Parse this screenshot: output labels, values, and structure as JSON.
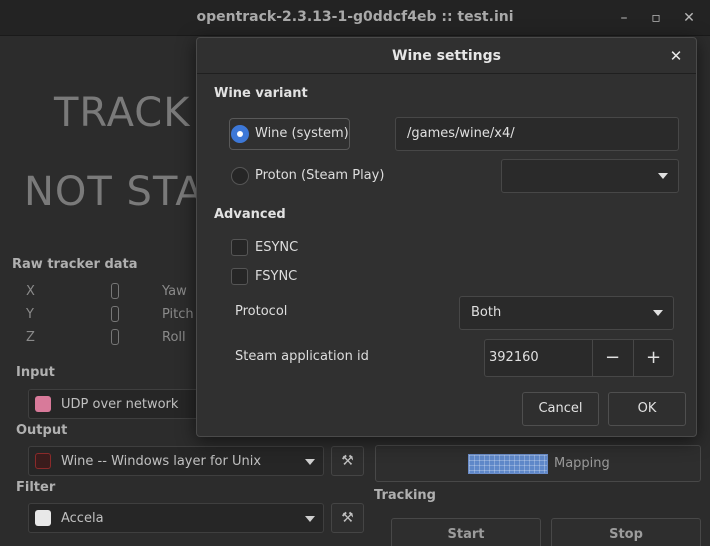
{
  "window": {
    "title": "opentrack-2.3.13-1-g0ddcf4eb :: test.ini",
    "minimize_glyph": "–",
    "maximize_glyph": "▫",
    "close_glyph": "✕"
  },
  "main": {
    "status_line1": "TRACK",
    "status_line2": "NOT STA",
    "raw_tracker_label": "Raw tracker data",
    "axes": [
      {
        "name": "X"
      },
      {
        "name": "Y"
      },
      {
        "name": "Z"
      },
      {
        "name": "Yaw"
      },
      {
        "name": "Pitch"
      },
      {
        "name": "Roll"
      }
    ],
    "input": {
      "label": "Input",
      "value": "UDP over network",
      "icon": "octopus-icon"
    },
    "output": {
      "label": "Output",
      "value": "Wine -- Windows layer for Unix",
      "icon": "wine-glass-icon",
      "tool_glyph": "⚒"
    },
    "filter": {
      "label": "Filter",
      "value": "Accela",
      "icon": "accela-icon",
      "tool_glyph": "⚒"
    },
    "mapping_label": "Mapping",
    "tracking_label": "Tracking",
    "start_label": "Start",
    "stop_label": "Stop"
  },
  "dialog": {
    "title": "Wine settings",
    "close_glyph": "✕",
    "wine_variant_label": "Wine variant",
    "wine_system_label": "Wine (system)",
    "wine_system_selected": true,
    "wine_path": "/games/wine/x4/",
    "proton_label": "Proton (Steam Play)",
    "proton_selected": false,
    "proton_version": "",
    "advanced_label": "Advanced",
    "esync_label": "ESYNC",
    "esync_checked": false,
    "fsync_label": "FSYNC",
    "fsync_checked": false,
    "protocol_label": "Protocol",
    "protocol_value": "Both",
    "steam_app_label": "Steam application id",
    "steam_app_id": "392160",
    "decrement_glyph": "−",
    "increment_glyph": "+",
    "cancel_label": "Cancel",
    "ok_label": "OK"
  },
  "colors": {
    "accent": "#3d78d8",
    "background": "#2c2c2c",
    "dialog_background": "#303030"
  }
}
